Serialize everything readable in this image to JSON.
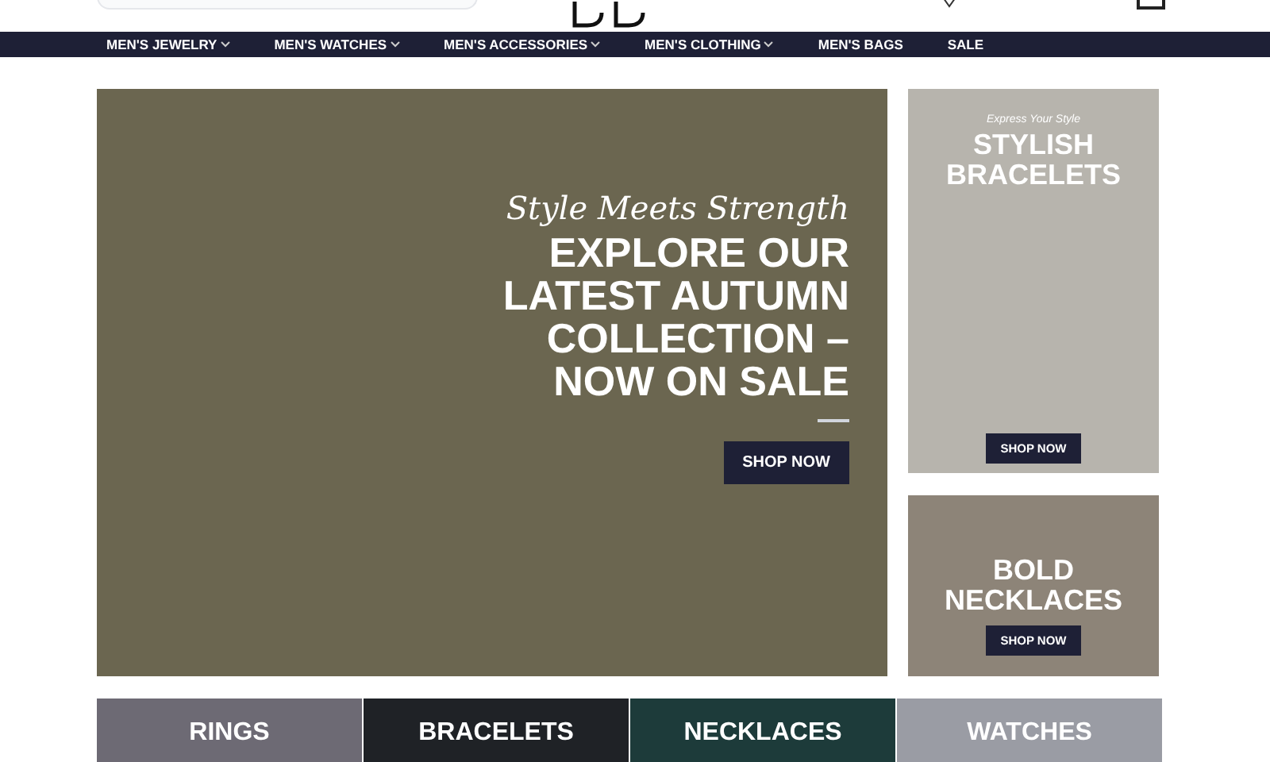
{
  "nav": [
    {
      "label": "MEN'S JEWELRY",
      "dropdown": true
    },
    {
      "label": "MEN'S WATCHES",
      "dropdown": true
    },
    {
      "label": "MEN'S ACCESSORIES",
      "dropdown": true
    },
    {
      "label": "MEN'S CLOTHING",
      "dropdown": true
    },
    {
      "label": "MEN'S BAGS",
      "dropdown": false
    },
    {
      "label": "SALE",
      "dropdown": false
    }
  ],
  "hero": {
    "tagline": "Style Meets Strength",
    "heading": "EXPLORE OUR LATEST AUTUMN COLLECTION – NOW ON SALE",
    "button": "SHOP NOW"
  },
  "promos": [
    {
      "tagline": "Express Your Style",
      "heading": "STYLISH BRACELETS",
      "button": "SHOP NOW"
    },
    {
      "heading": "BOLD NECKLACES",
      "button": "SHOP NOW"
    }
  ],
  "categories": [
    "RINGS",
    "BRACELETS",
    "NECKLACES",
    "WATCHES"
  ]
}
